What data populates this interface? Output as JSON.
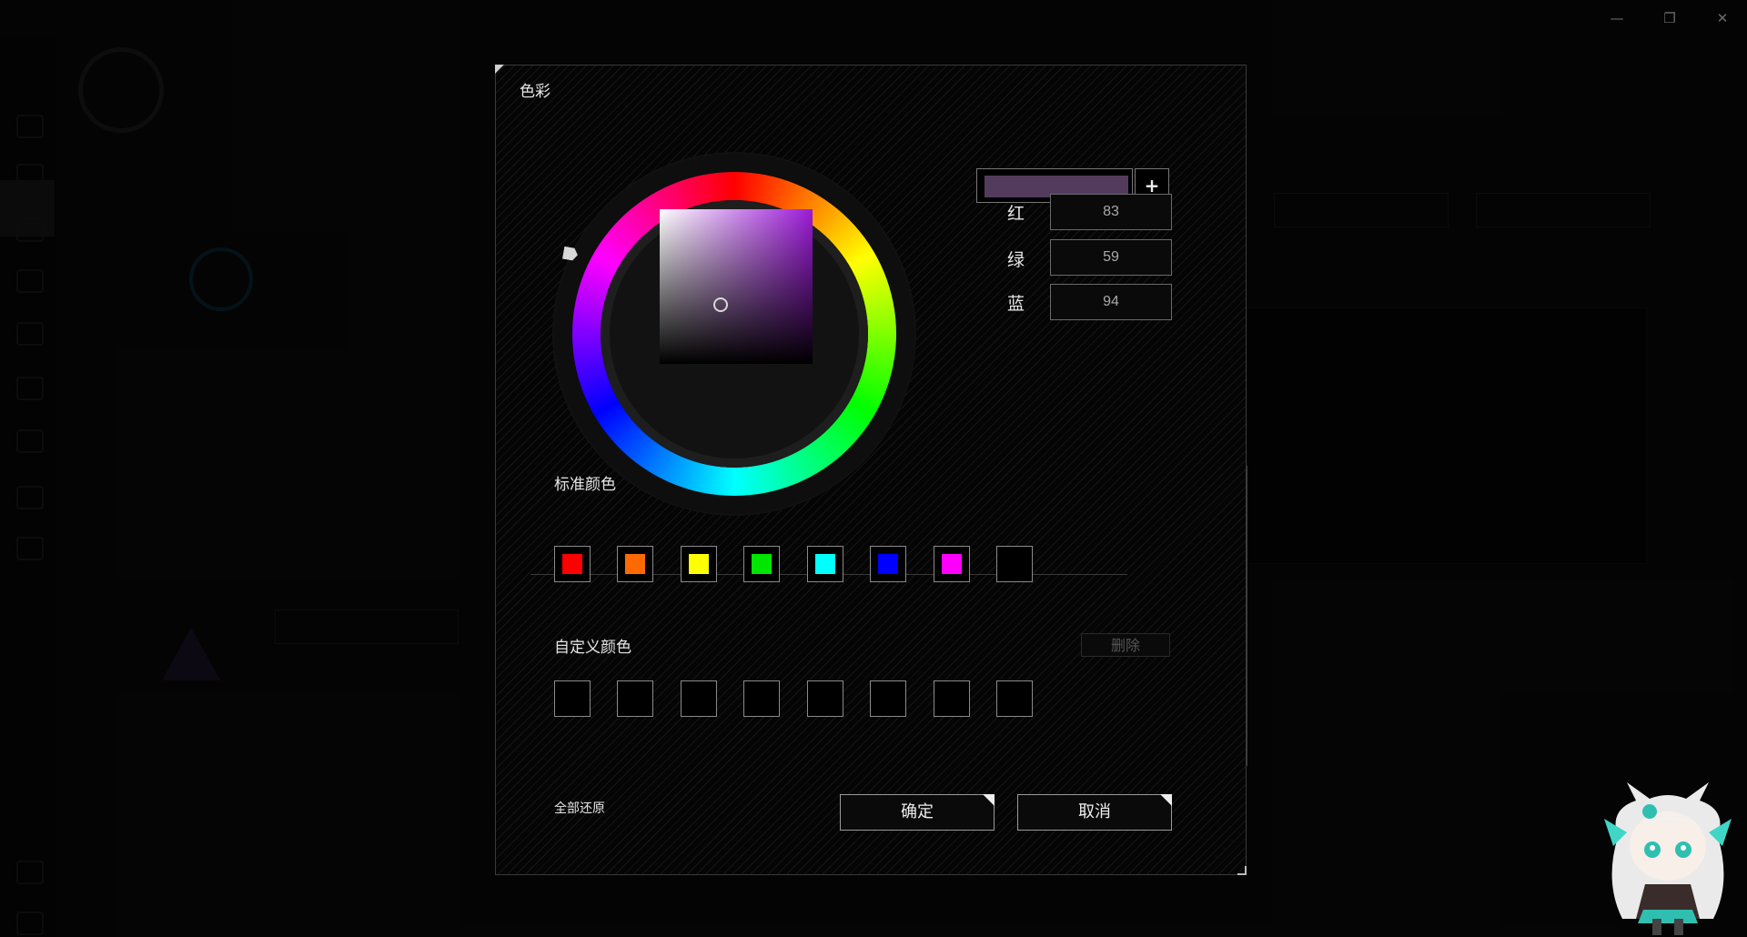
{
  "window": {
    "minimize_icon": "minimize-icon",
    "maximize_icon": "restore-icon",
    "close_icon": "close-icon"
  },
  "dialog": {
    "title": "色彩",
    "preview_color": "#533b5e",
    "add_label": "+",
    "rgb": [
      {
        "label": "红",
        "value": "83"
      },
      {
        "label": "绿",
        "value": "59"
      },
      {
        "label": "蓝",
        "value": "94"
      }
    ],
    "standard_label": "标准颜色",
    "standard_colors": [
      "#ff0000",
      "#ff6a00",
      "#ffff00",
      "#00e600",
      "#00ffff",
      "#0000ff",
      "#ff00ff",
      "#000000"
    ],
    "custom_label": "自定义颜色",
    "delete_label": "删除",
    "reset_label": "全部还原",
    "ok_label": "确定",
    "cancel_label": "取消"
  }
}
